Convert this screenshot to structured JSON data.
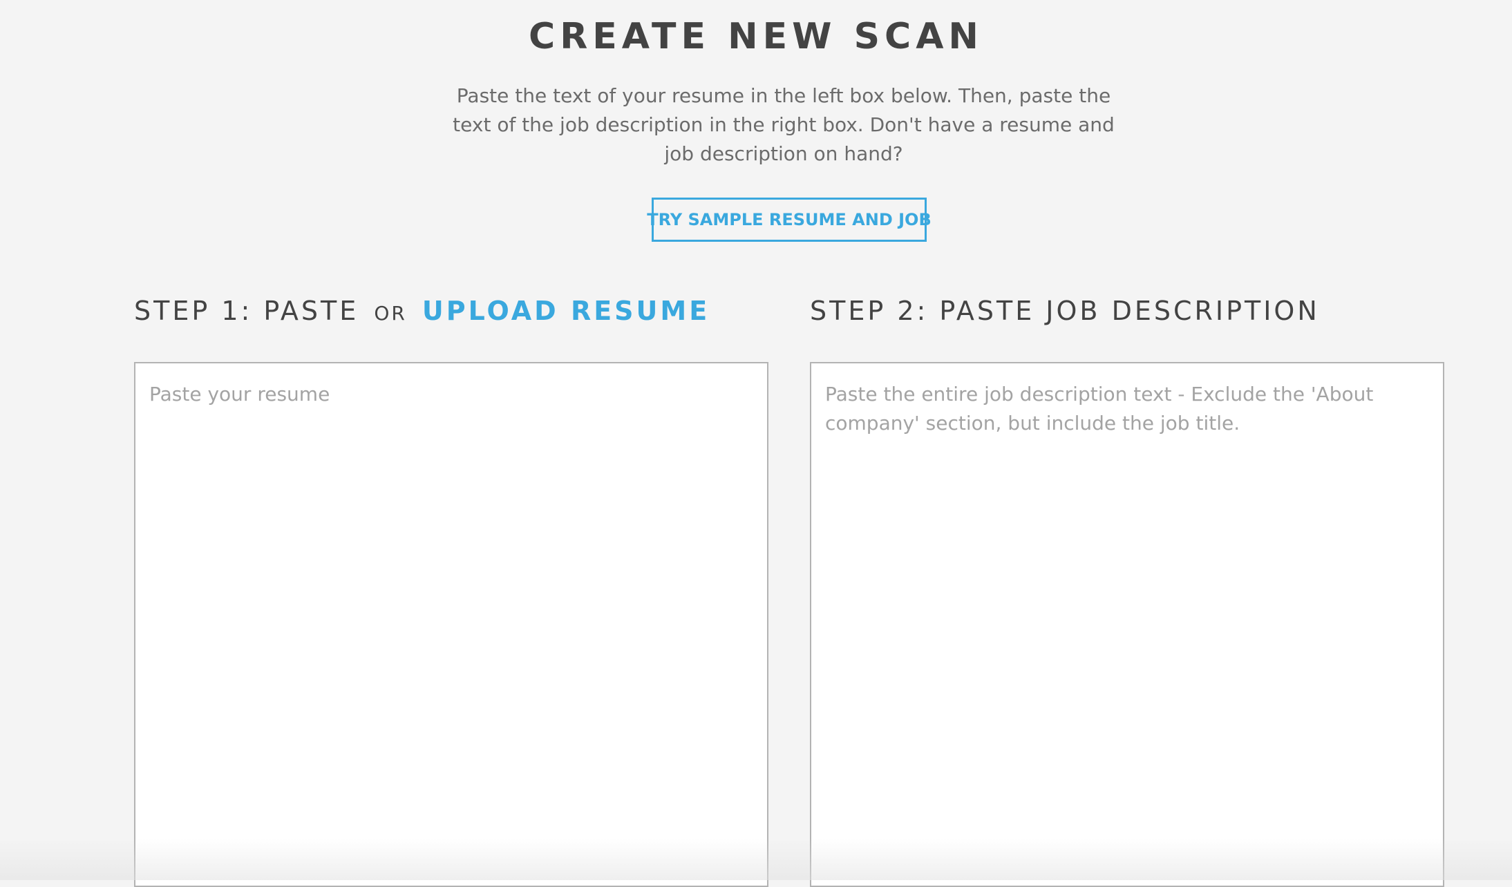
{
  "header": {
    "title": "CREATE NEW SCAN",
    "intro": "Paste the text of your resume in the left box below. Then, paste the text of the job description in the right box. Don't have a resume and job description on hand?",
    "sample_button_label": "TRY SAMPLE RESUME AND JOB"
  },
  "step1": {
    "prefix": "STEP 1: PASTE",
    "or": "OR",
    "upload_link": "UPLOAD RESUME",
    "placeholder": "Paste your resume",
    "value": ""
  },
  "step2": {
    "heading": "STEP 2: PASTE JOB DESCRIPTION",
    "placeholder": "Paste the entire job description text - Exclude the 'About company' section, but include the job title.",
    "value": ""
  },
  "colors": {
    "accent": "#3aa8de",
    "background": "#f4f4f4",
    "heading": "#434343",
    "body_text": "#6b6b6b",
    "placeholder": "#a3a3a3"
  }
}
